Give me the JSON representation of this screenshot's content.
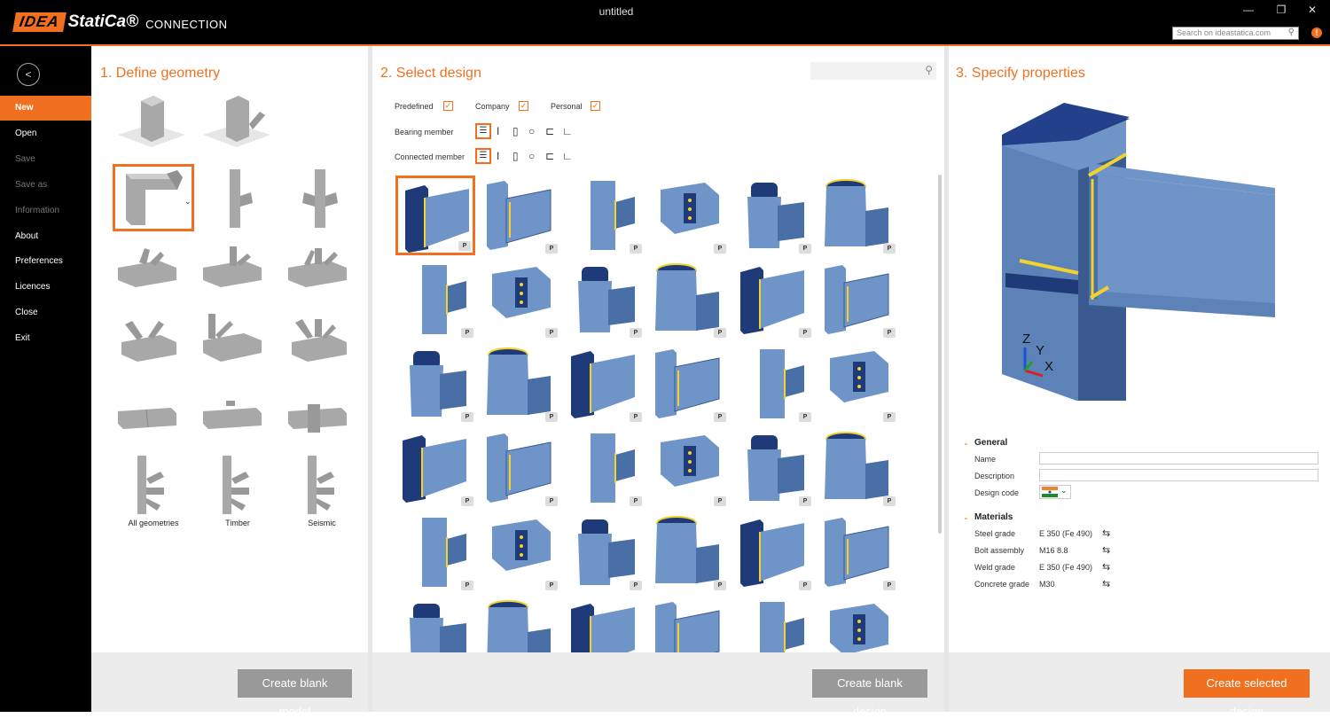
{
  "app": {
    "logo_idea": "IDEA",
    "logo_statica": "StatiCa®",
    "product": "CONNECTION",
    "window_title": "untitled",
    "search_placeholder": "Search on ideastatica.com",
    "info_icon": "!"
  },
  "window_controls": {
    "minimize": "—",
    "restore": "❐",
    "close": "✕"
  },
  "sidebar": {
    "back_icon": "<",
    "items": [
      {
        "label": "New",
        "state": "active"
      },
      {
        "label": "Open",
        "state": "normal"
      },
      {
        "label": "Save",
        "state": "disabled"
      },
      {
        "label": "Save as",
        "state": "disabled"
      },
      {
        "label": "Information",
        "state": "disabled"
      },
      {
        "label": "About",
        "state": "normal"
      },
      {
        "label": "Preferences",
        "state": "normal"
      },
      {
        "label": "Licences",
        "state": "normal"
      },
      {
        "label": "Close",
        "state": "normal"
      },
      {
        "label": "Exit",
        "state": "normal"
      }
    ]
  },
  "geometry": {
    "title": "1. Define geometry",
    "labels": [
      "All geometries",
      "Timber",
      "Seismic"
    ],
    "create_blank": "Create blank model"
  },
  "design": {
    "title": "2. Select design",
    "filters": [
      "Predefined",
      "Company",
      "Personal"
    ],
    "check_mark": "✓",
    "bearing_member": "Bearing member",
    "connected_member": "Connected member",
    "section_icons": [
      "I",
      "▯",
      "○",
      "⊏",
      "∟"
    ],
    "tile_tag": "P",
    "create_blank": "Create blank design"
  },
  "properties": {
    "title": "3. Specify properties",
    "axes": {
      "z": "Z",
      "y": "Y",
      "x": "X"
    },
    "general": "General",
    "name_label": "Name",
    "description_label": "Description",
    "design_code_label": "Design code",
    "materials": "Materials",
    "rows": [
      {
        "key": "Steel grade",
        "value": "E 350 (Fe 490)"
      },
      {
        "key": "Bolt assembly",
        "value": "M16 8.8"
      },
      {
        "key": "Weld grade",
        "value": "E 350 (Fe 490)"
      },
      {
        "key": "Concrete grade",
        "value": "M30"
      }
    ],
    "create_selected": "Create selected design"
  },
  "colors": {
    "accent": "#f07020",
    "steel": "#6f95c8",
    "steel_dark": "#1f3a78",
    "weld": "#f2d22c",
    "geometry_gray": "#a8a8a8"
  }
}
